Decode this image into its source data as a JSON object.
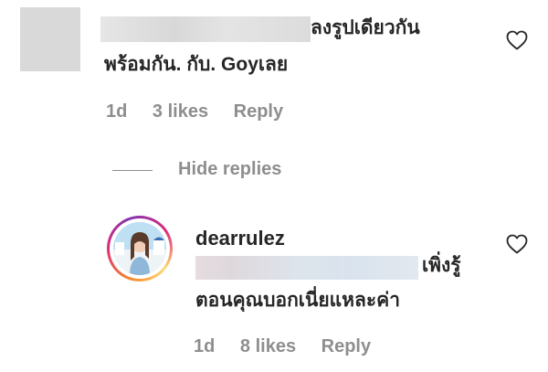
{
  "comment": {
    "text_line1": "ลงรูปเดียวกัน",
    "text_line2": "พร้อมกัน. กับ. Goyเลย",
    "time": "1d",
    "likes": "3 likes",
    "reply_label": "Reply",
    "like_icon": "heart-outline-icon"
  },
  "replies_toggle": {
    "label": "Hide replies"
  },
  "reply": {
    "username": "dearrulez",
    "text_line1": "เพิ่งรู้",
    "text_line2": "ตอนคุณบอกเนี่ยแหละค่า",
    "time": "1d",
    "likes": "8 likes",
    "reply_label": "Reply",
    "like_icon": "heart-outline-icon"
  }
}
